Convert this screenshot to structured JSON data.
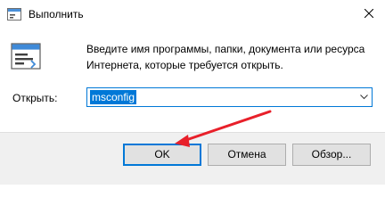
{
  "window": {
    "title": "Выполнить"
  },
  "dialog": {
    "description": "Введите имя программы, папки, документа или ресурса Интернета, которые требуется открыть.",
    "open_label": "Открыть:",
    "open_value": "msconfig"
  },
  "buttons": {
    "ok": "OK",
    "cancel": "Отмена",
    "browse": "Обзор..."
  },
  "icons": {
    "app": "run-app-icon",
    "run": "run-program-icon",
    "close": "close-icon",
    "dropdown": "chevron-down-icon",
    "annotation": "red-arrow-annotation"
  },
  "colors": {
    "accent": "#0078d7",
    "annotation": "#e8202a",
    "footer": "#f0f0f0"
  }
}
